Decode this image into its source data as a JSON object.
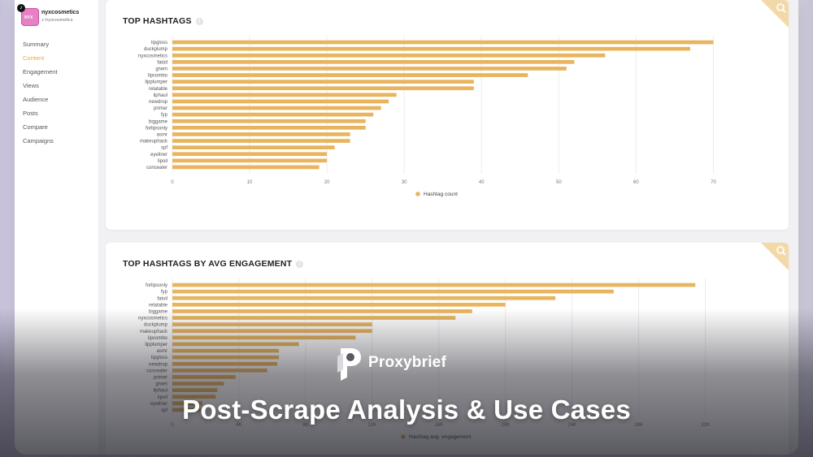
{
  "profile": {
    "name": "nyxcosmetics",
    "handle": "/nyxcosmetics",
    "avatar_text": "NYX"
  },
  "sidebar": {
    "items": [
      {
        "label": "Summary",
        "active": false
      },
      {
        "label": "Content",
        "active": true
      },
      {
        "label": "Engagement",
        "active": false
      },
      {
        "label": "Views",
        "active": false
      },
      {
        "label": "Audience",
        "active": false
      },
      {
        "label": "Posts",
        "active": false
      },
      {
        "label": "Compare",
        "active": false
      },
      {
        "label": "Campaigns",
        "active": false
      }
    ]
  },
  "colors": {
    "accent": "#e0a94a",
    "bar": "#e8b45e",
    "active_nav": "#e0a94a"
  },
  "cards": [
    {
      "title": "TOP HASHTAGS",
      "info_icon": "info-icon",
      "corner_icon": "search-icon",
      "chart_data": {
        "type": "bar",
        "orientation": "horizontal",
        "categories": [
          "lipgloss",
          "duckplump",
          "nyxcosmetics",
          "fatoil",
          "grwm",
          "lipcombo",
          "lipplumper",
          "relatable",
          "liphaul",
          "newdrop",
          "primer",
          "fyp",
          "biggame",
          "forlipsonly",
          "asmr",
          "makeuphack",
          "spf",
          "eyeliner",
          "lipoil",
          "concealer"
        ],
        "series": [
          {
            "name": "Hashtag count",
            "values": [
              70,
              67,
              56,
              52,
              51,
              46,
              39,
              39,
              29,
              28,
              27,
              26,
              25,
              25,
              23,
              23,
              21,
              20,
              20,
              19
            ]
          }
        ],
        "xlim": [
          0,
          75
        ],
        "xticks": [
          0,
          10,
          20,
          30,
          40,
          50,
          60,
          70
        ],
        "grid": true,
        "legend": "bottom"
      }
    },
    {
      "title": "TOP HASHTAGS BY AVG ENGAGEMENT",
      "info_icon": "info-icon",
      "corner_icon": "search-icon",
      "chart_data": {
        "type": "bar",
        "orientation": "horizontal",
        "categories": [
          "forlipsonly",
          "fyp",
          "fatoil",
          "relatable",
          "biggame",
          "nyxcosmetics",
          "duckplump",
          "makeuphack",
          "lipcombo",
          "lipplumper",
          "asmr",
          "lipgloss",
          "newdrop",
          "concealer",
          "primer",
          "grwm",
          "liphaul",
          "lipoil",
          "eyeliner",
          "spf"
        ],
        "series": [
          {
            "name": "Hashtag avg. engagement",
            "values": [
              31.4,
              26.5,
              23.0,
              20.0,
              18.0,
              17.0,
              12.0,
              12.0,
              11.0,
              7.6,
              6.4,
              6.4,
              6.3,
              5.7,
              3.8,
              3.1,
              2.7,
              2.6,
              1.8,
              1.7
            ]
          }
        ],
        "xlim": [
          0,
          33
        ],
        "xticks": [
          0,
          4,
          8,
          12,
          16,
          20,
          24,
          28,
          32
        ],
        "xtick_labels": [
          "0",
          "4K",
          "8K",
          "12K",
          "16K",
          "20K",
          "24K",
          "28K",
          "32K"
        ],
        "grid": true,
        "legend": "bottom"
      }
    }
  ],
  "overlay": {
    "brand": "Proxybrief",
    "headline": "Post-Scrape Analysis & Use Cases"
  }
}
